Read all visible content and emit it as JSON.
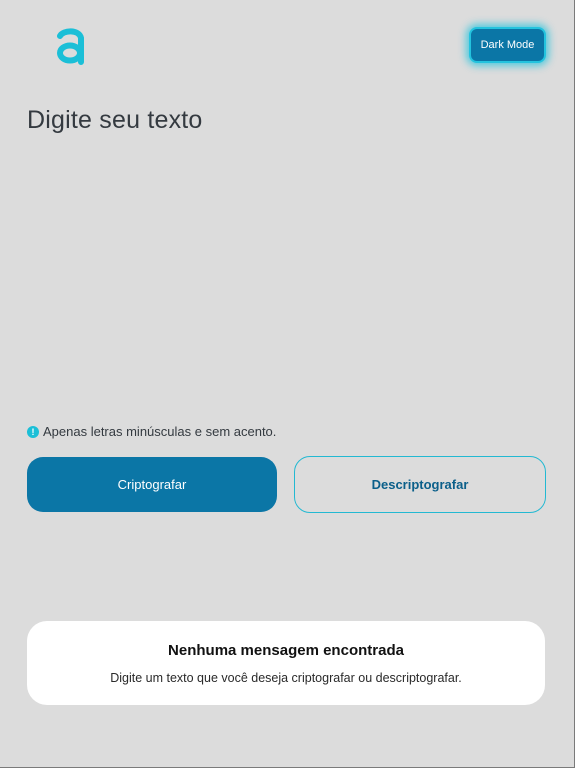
{
  "header": {
    "logo_icon": "letter-a-logo",
    "dark_mode_label": "Dark Mode"
  },
  "main": {
    "heading": "Digite seu texto",
    "hint_icon": "exclamation-icon",
    "hint_text": "Apenas letras minúsculas e sem acento.",
    "encrypt_label": "Criptografar",
    "decrypt_label": "Descriptografar"
  },
  "output": {
    "title": "Nenhuma mensagem encontrada",
    "text": "Digite um texto que você deseja criptografar ou descriptografar."
  },
  "colors": {
    "accent": "#0b76a6",
    "highlight": "#23c3de",
    "background": "#dcdcdc"
  }
}
